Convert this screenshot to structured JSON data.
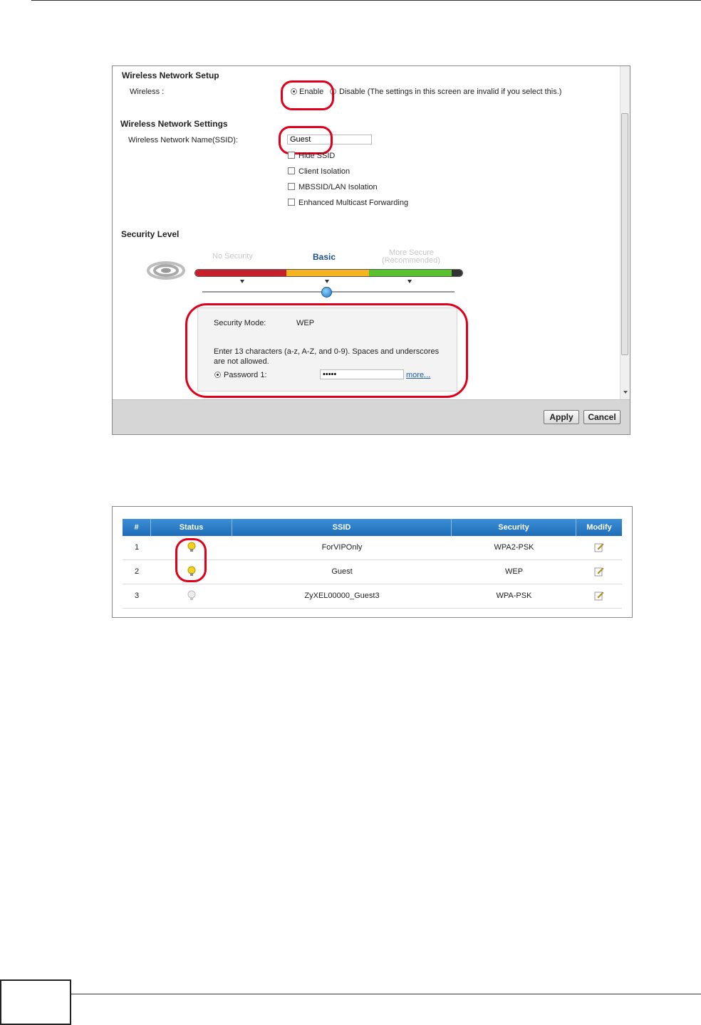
{
  "wireless_setup": {
    "title": "Wireless Network Setup",
    "wireless_label": "Wireless :",
    "enable_label": "Enable",
    "disable_label": "Disable (The settings in this screen are invalid if you select this.)"
  },
  "wireless_settings": {
    "title": "Wireless Network Settings",
    "ssid_label": "Wireless Network Name(SSID):",
    "ssid_value": "Guest",
    "options": [
      "Hide SSID",
      "Client Isolation",
      "MBSSID/LAN Isolation",
      "Enhanced Multicast Forwarding"
    ]
  },
  "security_level": {
    "title": "Security Level",
    "levels": [
      "No Security",
      "Basic",
      "More Secure",
      "(Recommended)"
    ],
    "mode_label": "Security Mode:",
    "mode_value": "WEP",
    "hint_line1": "Enter 13 characters (a-z, A-Z, and 0-9). Spaces and underscores",
    "hint_line2": "are not allowed.",
    "password_label": "Password 1:",
    "password_value": "•••••",
    "more_link": "more..."
  },
  "buttons": {
    "apply": "Apply",
    "cancel": "Cancel"
  },
  "ssid_table": {
    "headers": [
      "#",
      "Status",
      "SSID",
      "Security",
      "Modify"
    ],
    "rows": [
      {
        "num": "1",
        "ssid": "ForVIPOnly",
        "security": "WPA2-PSK"
      },
      {
        "num": "2",
        "ssid": "Guest",
        "security": "WEP"
      },
      {
        "num": "3",
        "ssid": "ZyXEL00000_Guest3",
        "security": "WPA-PSK"
      }
    ]
  },
  "colors": {
    "accent_red": "#e0001b",
    "header_blue": "#2a7cc7",
    "bulb_on": "#f2d21b",
    "bulb_off": "#d5d5d5"
  },
  "icons": {
    "status_on": "lightbulb-on-icon",
    "status_off": "lightbulb-off-icon",
    "modify": "edit-icon",
    "wireless": "wifi-icon"
  }
}
